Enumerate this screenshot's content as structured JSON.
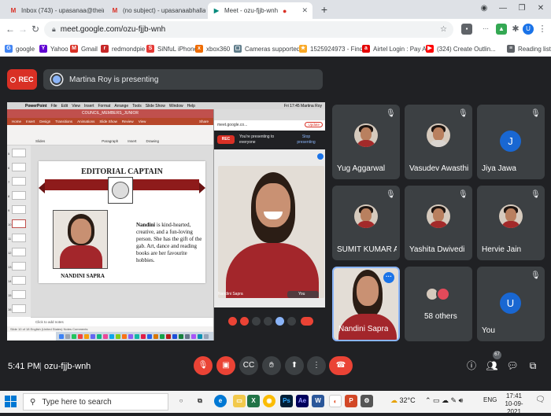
{
  "browser": {
    "tabs": [
      {
        "label": "Inbox (743) - upasanaa@theindi",
        "icon": "gmail-icon"
      },
      {
        "label": "(no subject) - upasanaabhalla13@",
        "icon": "gmail-icon"
      },
      {
        "label": "Meet - ozu-fjjb-wnh",
        "icon": "meet-icon",
        "active": true
      }
    ],
    "url": "meet.google.com/ozu-fjjb-wnh",
    "bookmarks": [
      "google",
      "Yahoo",
      "Gmail",
      "redmondpie",
      "SiNfuL iPhone",
      "xbox360",
      "Cameras supported...",
      "1525924973 - Find...",
      "Airtel Login : Pay Ai...",
      "(324) Create Outlin..."
    ],
    "reading_list": "Reading list",
    "profile_letter": "U"
  },
  "meet": {
    "rec_label": "REC",
    "presenting_text": "Martina Roy is presenting",
    "time": "5:41 PM",
    "separator": "|",
    "meeting_code": "ozu-fjjb-wnh",
    "participant_count": "67",
    "tiles": [
      {
        "name": "Yug Aggarwal",
        "type": "photo"
      },
      {
        "name": "Vasudev Awasthi",
        "type": "photo"
      },
      {
        "name": "Jiya Jawa",
        "type": "letter",
        "letter": "J"
      },
      {
        "name": "SUMIT KUMAR AG...",
        "type": "photo"
      },
      {
        "name": "Yashita Dwivedi",
        "type": "photo"
      },
      {
        "name": "Hervie Jain",
        "type": "photo"
      },
      {
        "name": "Nandini Sapra",
        "type": "self"
      },
      {
        "name": "58 others",
        "type": "others"
      },
      {
        "name": "You",
        "type": "letter",
        "letter": "U"
      }
    ]
  },
  "presentation": {
    "mac_menu": [
      "PowerPoint",
      "File",
      "Edit",
      "View",
      "Insert",
      "Format",
      "Arrange",
      "Tools",
      "Slide Show",
      "Window",
      "Help"
    ],
    "mac_right": "Fri 17:45  Martina Roy",
    "ppt_title": "COUNCIL_MEMBERS_JUNIOR",
    "ppt_tabs": [
      "Home",
      "Insert",
      "Design",
      "Transitions",
      "Animations",
      "Slide Show",
      "Review",
      "View"
    ],
    "ribbon": [
      "Slides",
      "Paragraph",
      "Insert",
      "Drawing"
    ],
    "share": "Share",
    "slide_title": "EDITORIAL CAPTAIN",
    "student_name": "NANDINI SAPRA",
    "desc_bold": "Nandini",
    "desc_rest": " is kind-hearted, creative, and a fun-loving person. She has the gift of the gab. Art, dance and reading books are her favourite hobbies.",
    "notes": "Click to add notes",
    "status": "Slide 10 of 18    English (United States)    Notes    Comments",
    "thumb_numbers": [
      "5",
      "6",
      "7",
      "8",
      "9",
      "10",
      "11",
      "12",
      "13",
      "14",
      "15",
      "16"
    ],
    "inner": {
      "url": "meet.google.co...",
      "update": "Update",
      "rec": "REC",
      "presenting_msg": "You're presenting to everyone",
      "stop": "Stop presenting",
      "name": "Nandini Sapra",
      "you": "You"
    }
  },
  "taskbar": {
    "search_placeholder": "Type here to search",
    "temperature": "32°C",
    "lang": "ENG",
    "time": "17:41",
    "date": "10-09-2021"
  }
}
